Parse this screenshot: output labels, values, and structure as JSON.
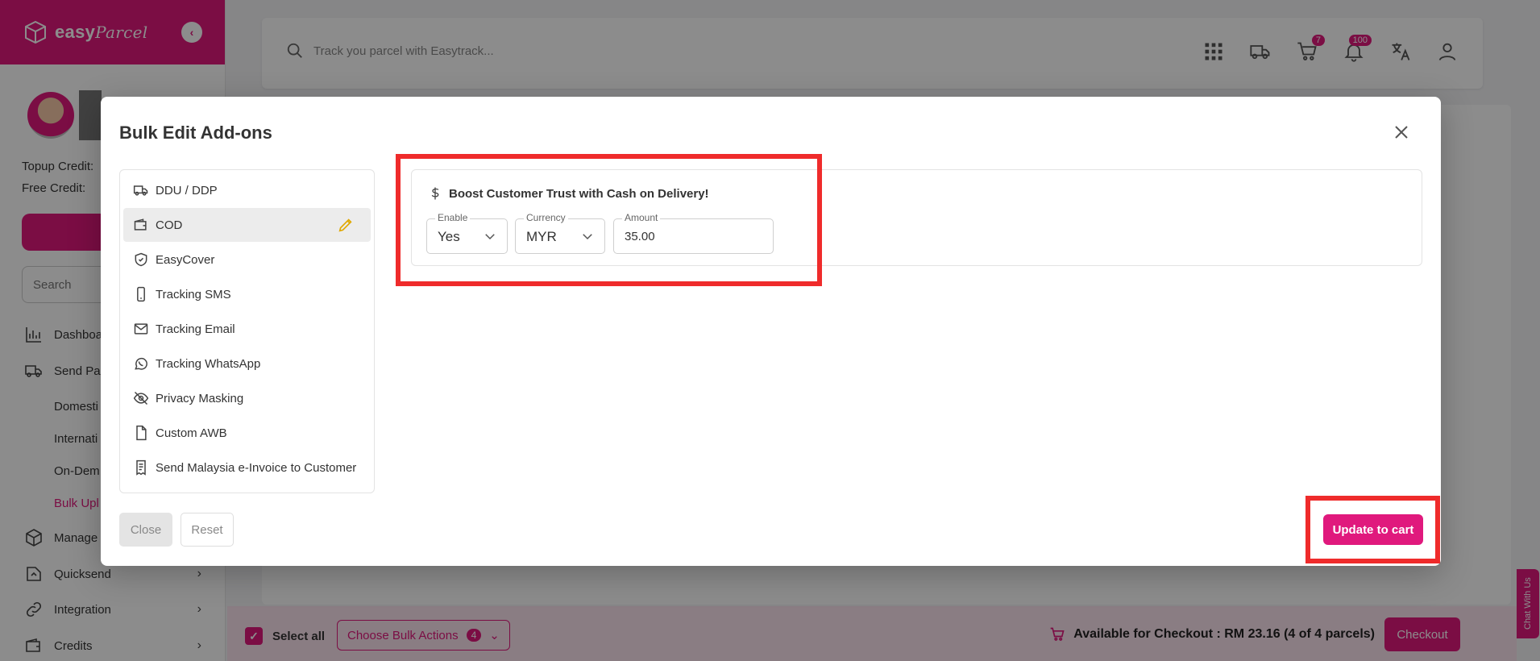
{
  "brand": {
    "name": "easy",
    "name_italic": "Parcel"
  },
  "sidebar": {
    "topup_credit_label": "Topup Credit:",
    "free_credit_label": "Free Credit:",
    "search_placeholder": "Search",
    "items": [
      {
        "label": "Dashboa"
      },
      {
        "label": "Send Par"
      },
      {
        "label": "Domesti"
      },
      {
        "label": "Internati"
      },
      {
        "label": "On-Dem"
      },
      {
        "label": "Bulk Upl"
      },
      {
        "label": "Manage"
      },
      {
        "label": "Quicksend"
      },
      {
        "label": "Integration"
      },
      {
        "label": "Credits"
      }
    ]
  },
  "topbar": {
    "search_placeholder": "Track you parcel with Easytrack...",
    "cart_count": "7",
    "notif_count": "100"
  },
  "bottom": {
    "select_all": "Select all",
    "bulk_actions": "Choose Bulk Actions",
    "bulk_count": "4",
    "checkout_info": "Available for Checkout : RM 23.16 (4 of 4 parcels)",
    "checkout": "Checkout",
    "chat": "Chat With Us"
  },
  "modal": {
    "title": "Bulk Edit Add-ons",
    "addons": [
      {
        "label": "DDU / DDP",
        "icon": "truck-icon"
      },
      {
        "label": "COD",
        "icon": "wallet-icon",
        "selected": true
      },
      {
        "label": "EasyCover",
        "icon": "shield-icon"
      },
      {
        "label": "Tracking SMS",
        "icon": "phone-icon"
      },
      {
        "label": "Tracking Email",
        "icon": "mail-icon"
      },
      {
        "label": "Tracking WhatsApp",
        "icon": "whatsapp-icon"
      },
      {
        "label": "Privacy Masking",
        "icon": "eye-off-icon"
      },
      {
        "label": "Custom AWB",
        "icon": "file-icon"
      },
      {
        "label": "Send Malaysia e-Invoice to Customer",
        "icon": "receipt-icon"
      }
    ],
    "cod": {
      "heading": "Boost Customer Trust with Cash on Delivery!",
      "enable_label": "Enable",
      "enable_value": "Yes",
      "currency_label": "Currency",
      "currency_value": "MYR",
      "amount_label": "Amount",
      "amount_value": "35.00"
    },
    "close_btn": "Close",
    "reset_btn": "Reset",
    "update_btn": "Update to cart"
  },
  "colors": {
    "accent": "#e0197d",
    "highlight": "#ef2b2b"
  }
}
